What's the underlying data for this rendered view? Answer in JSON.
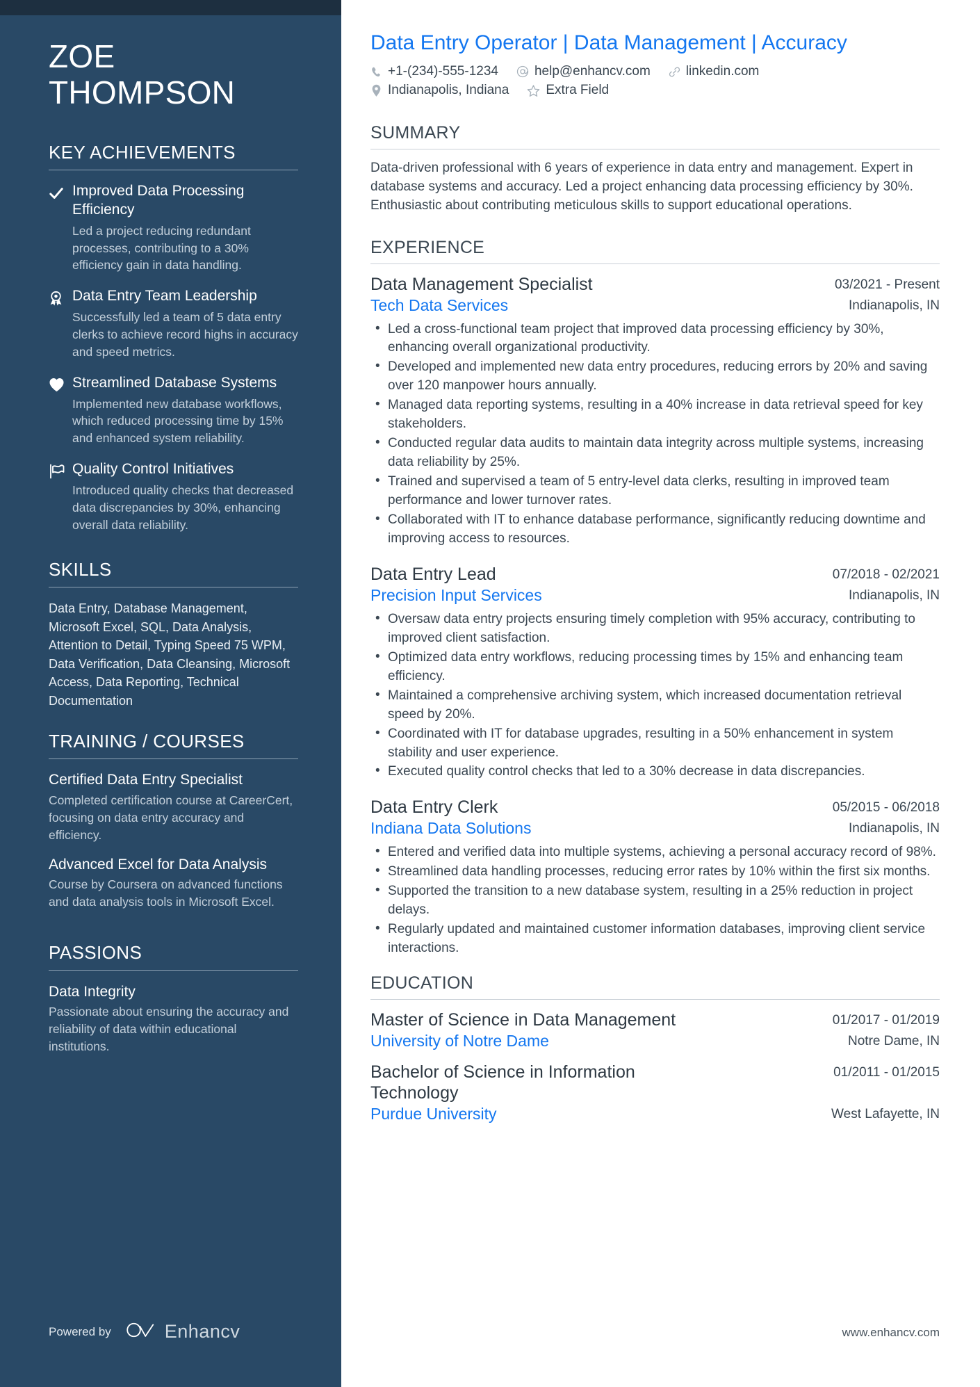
{
  "sidebar": {
    "name_lines": [
      "ZOE",
      "THOMPSON"
    ],
    "sections": {
      "achievements_heading": "KEY ACHIEVEMENTS",
      "skills_heading": "SKILLS",
      "training_heading": "TRAINING / COURSES",
      "passions_heading": "PASSIONS"
    },
    "achievements": [
      {
        "icon": "check-icon",
        "title": "Improved Data Processing Efficiency",
        "desc": "Led a project reducing redundant processes, contributing to a 30% efficiency gain in data handling."
      },
      {
        "icon": "award-ribbon-icon",
        "title": "Data Entry Team Leadership",
        "desc": "Successfully led a team of 5 data entry clerks to achieve record highs in accuracy and speed metrics."
      },
      {
        "icon": "heart-icon",
        "title": "Streamlined Database Systems",
        "desc": "Implemented new database workflows, which reduced processing time by 15% and enhanced system reliability."
      },
      {
        "icon": "flag-icon",
        "title": "Quality Control Initiatives",
        "desc": "Introduced quality checks that decreased data discrepancies by 30%, enhancing overall data reliability."
      }
    ],
    "skills_text": "Data Entry, Database Management, Microsoft Excel, SQL, Data Analysis, Attention to Detail, Typing Speed 75 WPM, Data Verification, Data Cleansing, Microsoft Access, Data Reporting, Technical Documentation",
    "courses": [
      {
        "title": "Certified Data Entry Specialist",
        "desc": "Completed certification course at CareerCert, focusing on data entry accuracy and efficiency."
      },
      {
        "title": "Advanced Excel for Data Analysis",
        "desc": "Course by Coursera on advanced functions and data analysis tools in Microsoft Excel."
      }
    ],
    "passions": [
      {
        "title": "Data Integrity",
        "desc": "Passionate about ensuring the accuracy and reliability of data within educational institutions."
      }
    ],
    "footer": {
      "powered_by": "Powered by",
      "brand": "Enhancv"
    }
  },
  "main": {
    "headline": "Data Entry Operator | Data Management | Accuracy",
    "contacts": [
      {
        "icon": "phone-icon",
        "text": "+1-(234)-555-1234"
      },
      {
        "icon": "email-at-icon",
        "text": "help@enhancv.com"
      },
      {
        "icon": "link-icon",
        "text": "linkedin.com"
      },
      {
        "icon": "location-pin-icon",
        "text": "Indianapolis, Indiana"
      },
      {
        "icon": "star-icon",
        "text": "Extra Field"
      }
    ],
    "summary_heading": "SUMMARY",
    "summary_text": "Data-driven professional with 6 years of experience in data entry and management. Expert in database systems and accuracy. Led a project enhancing data processing efficiency by 30%. Enthusiastic about contributing meticulous skills to support educational operations.",
    "experience_heading": "EXPERIENCE",
    "experience": [
      {
        "role": "Data Management Specialist",
        "dates": "03/2021 - Present",
        "org": "Tech Data Services",
        "location": "Indianapolis, IN",
        "bullets": [
          "Led a cross-functional team project that improved data processing efficiency by 30%, enhancing overall organizational productivity.",
          "Developed and implemented new data entry procedures, reducing errors by 20% and saving over 120 manpower hours annually.",
          "Managed data reporting systems, resulting in a 40% increase in data retrieval speed for key stakeholders.",
          "Conducted regular data audits to maintain data integrity across multiple systems, increasing data reliability by 25%.",
          "Trained and supervised a team of 5 entry-level data clerks, resulting in improved team performance and lower turnover rates.",
          "Collaborated with IT to enhance database performance, significantly reducing downtime and improving access to resources."
        ]
      },
      {
        "role": "Data Entry Lead",
        "dates": "07/2018 - 02/2021",
        "org": "Precision Input Services",
        "location": "Indianapolis, IN",
        "bullets": [
          "Oversaw data entry projects ensuring timely completion with 95% accuracy, contributing to improved client satisfaction.",
          "Optimized data entry workflows, reducing processing times by 15% and enhancing team efficiency.",
          "Maintained a comprehensive archiving system, which increased documentation retrieval speed by 20%.",
          "Coordinated with IT for database upgrades, resulting in a 50% enhancement in system stability and user experience.",
          "Executed quality control checks that led to a 30% decrease in data discrepancies."
        ]
      },
      {
        "role": "Data Entry Clerk",
        "dates": "05/2015 - 06/2018",
        "org": "Indiana Data Solutions",
        "location": "Indianapolis, IN",
        "bullets": [
          "Entered and verified data into multiple systems, achieving a personal accuracy record of 98%.",
          "Streamlined data handling processes, reducing error rates by 10% within the first six months.",
          "Supported the transition to a new database system, resulting in a 25% reduction in project delays.",
          "Regularly updated and maintained customer information databases, improving client service interactions."
        ]
      }
    ],
    "education_heading": "EDUCATION",
    "education": [
      {
        "degree": "Master of Science in Data Management",
        "dates": "01/2017 - 01/2019",
        "school": "University of Notre Dame",
        "location": "Notre Dame, IN"
      },
      {
        "degree": "Bachelor of Science in Information Technology",
        "dates": "01/2011 - 01/2015",
        "school": "Purdue University",
        "location": "West Lafayette, IN"
      }
    ],
    "footer_url": "www.enhancv.com"
  },
  "colors": {
    "sidebar_bg": "#294966",
    "sidebar_topbar": "#1d2f40",
    "accent_blue": "#1477f0",
    "body_text": "#3b4752"
  }
}
